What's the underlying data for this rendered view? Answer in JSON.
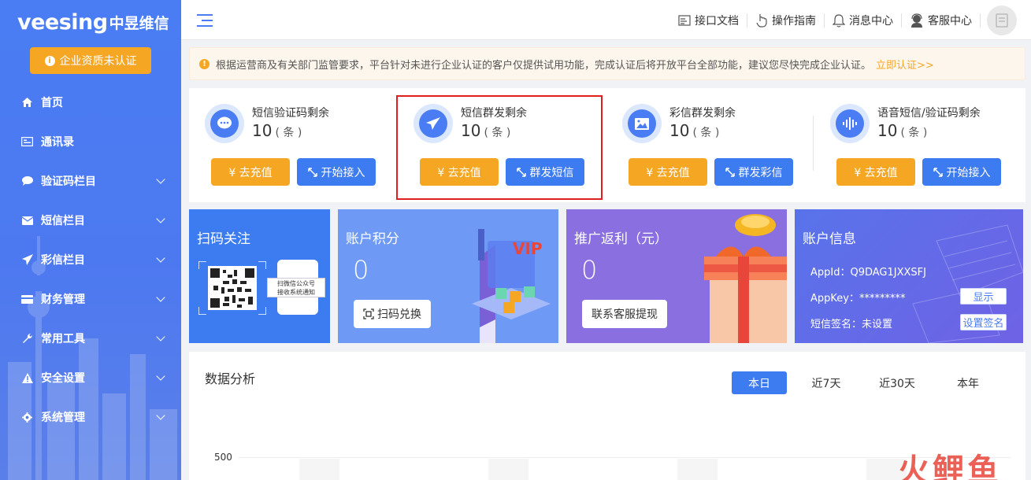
{
  "sidebar": {
    "logo_brand": "veesing",
    "logo_cn": "中昱维信",
    "cert_button": "企业资质未认证",
    "items": [
      {
        "label": "首页",
        "icon": "home-icon",
        "expandable": false
      },
      {
        "label": "通讯录",
        "icon": "contacts-icon",
        "expandable": false
      },
      {
        "label": "验证码栏目",
        "icon": "chat-icon",
        "expandable": true
      },
      {
        "label": "短信栏目",
        "icon": "mail-icon",
        "expandable": true
      },
      {
        "label": "彩信栏目",
        "icon": "send-icon",
        "expandable": true
      },
      {
        "label": "财务管理",
        "icon": "card-icon",
        "expandable": true
      },
      {
        "label": "常用工具",
        "icon": "wrench-icon",
        "expandable": true
      },
      {
        "label": "安全设置",
        "icon": "warning-icon",
        "expandable": true
      },
      {
        "label": "系统管理",
        "icon": "gear-icon",
        "expandable": true
      }
    ]
  },
  "header": {
    "links": [
      {
        "label": "接口文档",
        "icon": "doc-icon"
      },
      {
        "label": "操作指南",
        "icon": "pointer-icon"
      },
      {
        "label": "消息中心",
        "icon": "bell-icon"
      },
      {
        "label": "客服中心",
        "icon": "support-icon"
      }
    ]
  },
  "notice": {
    "text": "根据运营商及有关部门监管要求，平台针对未进行企业认证的客户仅提供试用功能，完成认证后将开放平台全部功能，建议您尽快完成企业认证。",
    "link": "立即认证>>"
  },
  "balances": [
    {
      "title": "短信验证码剩余",
      "count": "10",
      "unit": "( 条 )",
      "recharge": "¥ 去充值",
      "action": "开始接入",
      "icon": "chat-bubble-icon"
    },
    {
      "title": "短信群发剩余",
      "count": "10",
      "unit": "( 条 )",
      "recharge": "¥ 去充值",
      "action": "群发短信",
      "icon": "paper-plane-icon"
    },
    {
      "title": "彩信群发剩余",
      "count": "10",
      "unit": "( 条 )",
      "recharge": "¥ 去充值",
      "action": "群发彩信",
      "icon": "image-icon"
    },
    {
      "title": "语音短信/验证码剩余",
      "count": "10",
      "unit": "( 条 )",
      "recharge": "¥ 去充值",
      "action": "开始接入",
      "icon": "voice-icon"
    }
  ],
  "tiles": {
    "qr": {
      "title": "扫码关注",
      "phone_text_1": "扫微信公众号",
      "phone_text_2": "接收系统通知"
    },
    "points": {
      "title": "账户积分",
      "value": "0",
      "button": "扫码兑换",
      "art_text": "VIP"
    },
    "rebate": {
      "title": "推广返利（元）",
      "value": "0",
      "button": "联系客服提现"
    },
    "account": {
      "title": "账户信息",
      "appid_label": "AppId：",
      "appid": "Q9DAG1JXXSFJ",
      "appkey_label": "AppKey：",
      "appkey": "*********",
      "sign_label": "短信签名：",
      "sign": "未设置",
      "show_button": "显示",
      "set_sign_button": "设置签名"
    }
  },
  "analysis": {
    "title": "数据分析",
    "tabs": [
      "本日",
      "近7天",
      "近30天",
      "本年"
    ],
    "active_tab": 0,
    "y_tick": "500"
  },
  "watermark": "火鲤鱼",
  "colors": {
    "primary": "#3d7bf0",
    "orange": "#f5a623",
    "highlight": "#e02020"
  }
}
